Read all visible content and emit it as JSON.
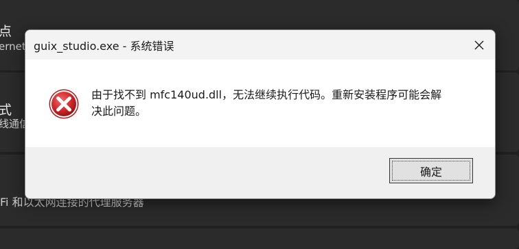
{
  "background": {
    "item1_title": "点",
    "item1_sub": "ernet",
    "item2_title": "式",
    "item2_sub": "线通信",
    "item3_text": "Fi 和以太网连接的代理服务器"
  },
  "dialog": {
    "title": "guix_studio.exe - 系统错误",
    "message_line1": "由于找不到 mfc140ud.dll，无法继续执行代码。重新安装程序可能会解",
    "message_line2": "决此问题。",
    "ok_label": "确定",
    "icon": "error-icon",
    "close_icon": "close-icon",
    "error_color": "#d42a2a"
  }
}
